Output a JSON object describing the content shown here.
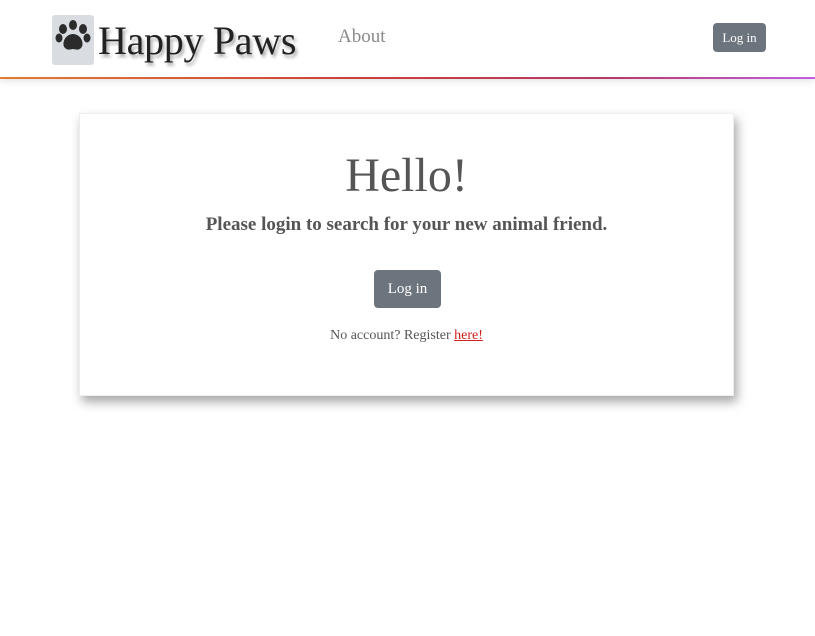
{
  "nav": {
    "brand": "Happy Paws",
    "logo_icon": "paw-icon",
    "about_label": "About",
    "login_label": "Log in"
  },
  "card": {
    "title": "Hello!",
    "subtitle": "Please login to search for your new animal friend.",
    "login_label": "Log in",
    "register_prefix": "No account? Register ",
    "register_link": "here!"
  },
  "colors": {
    "button_bg": "#6c757d",
    "link": "#d0211f",
    "gradient_start": "#e57a33",
    "gradient_end": "#c25fe3"
  }
}
